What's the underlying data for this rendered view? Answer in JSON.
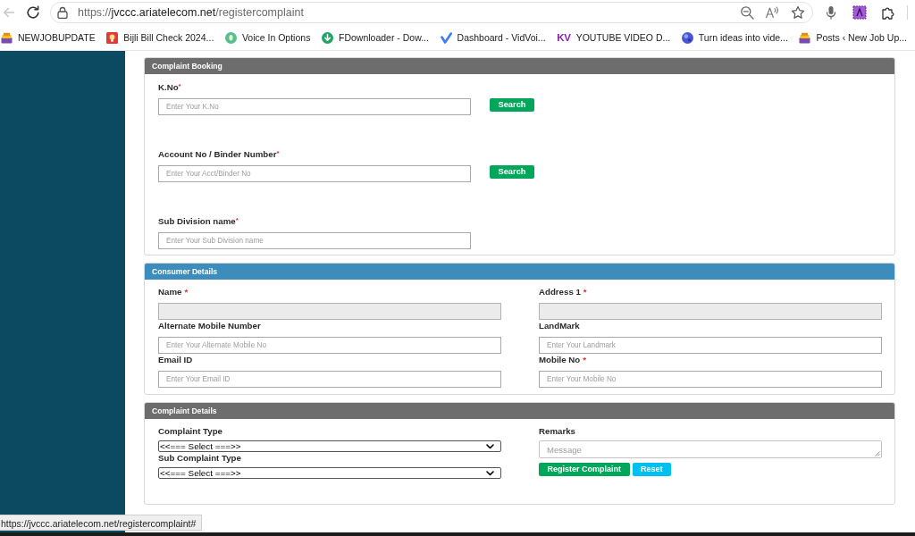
{
  "toolbar": {
    "back_button": {
      "disabled": true
    },
    "url": {
      "scheme": "https://",
      "host": "jvccc.ariatelecom.net",
      "path": "/registercomplaint"
    }
  },
  "bookmarks": [
    {
      "label": "NEWJOBUPDATE"
    },
    {
      "label": "Bijli Bill Check 2024..."
    },
    {
      "label": "Voice In Options"
    },
    {
      "label": "FDownloader - Dow..."
    },
    {
      "label": "Dashboard - VidVoi..."
    },
    {
      "badge": "KV",
      "label": "YOUTUBE VIDEO D..."
    },
    {
      "label": "Turn ideas into vide..."
    },
    {
      "label": "Posts ‹ New Job Up..."
    }
  ],
  "sections": [
    {
      "title": "Complaint Booking",
      "color": "#6d6d6d",
      "kind": "stacked",
      "columns": [
        [
          {
            "kind": "text",
            "label": "K.No",
            "required_mark": "*",
            "placeholder": "Enter Your K.No",
            "disabled": false,
            "button": "Search"
          },
          {
            "kind": "text",
            "label": "Account No / Binder Number",
            "required_mark": "*",
            "placeholder": "Enter Your Acct/Binder No",
            "disabled": false,
            "button": "Search"
          },
          {
            "kind": "text",
            "label": "Sub Division name",
            "required_mark": "*",
            "placeholder": "Enter Your Sub Division name",
            "disabled": false
          }
        ]
      ]
    },
    {
      "title": "Consumer Details",
      "color": "#3c8dbc",
      "kind": "grid",
      "columns": [
        [
          {
            "kind": "text",
            "label": "Name",
            "required_mark": "*",
            "disabled": true
          },
          {
            "kind": "text",
            "label": "Alternate Mobile Number",
            "placeholder": "Enter Your Alternate Mobile No",
            "disabled": false
          },
          {
            "kind": "text",
            "label": "Email ID",
            "placeholder": "Enter Your Email ID",
            "disabled": false
          }
        ],
        [
          {
            "kind": "text",
            "label": "Address 1",
            "required_mark": "*",
            "disabled": true
          },
          {
            "kind": "text",
            "label": "LandMark",
            "placeholder": "Enter Your Landmark",
            "disabled": false
          },
          {
            "kind": "text",
            "label": "Mobile No",
            "required_mark": "*",
            "placeholder": "Enter Your Mobile No",
            "disabled": false
          }
        ]
      ]
    },
    {
      "title": "Complaint Details",
      "color": "#6d6d6d",
      "kind": "grid",
      "columns": [
        [
          {
            "kind": "select",
            "label": "Complaint Type",
            "value": "<<=== Select ===>>"
          },
          {
            "kind": "select",
            "label": "Sub Complaint Type",
            "value": "<<=== Select ===>>"
          }
        ],
        [
          {
            "kind": "textarea",
            "label": "Remarks",
            "placeholder": "Message"
          }
        ]
      ],
      "actions": [
        {
          "label": "Register Complaint",
          "color": "#00a65a"
        },
        {
          "label": "Reset",
          "color": "#00c0ef"
        }
      ]
    }
  ],
  "status_url": "https://jvccc.ariatelecom.net/registercomplaint#"
}
